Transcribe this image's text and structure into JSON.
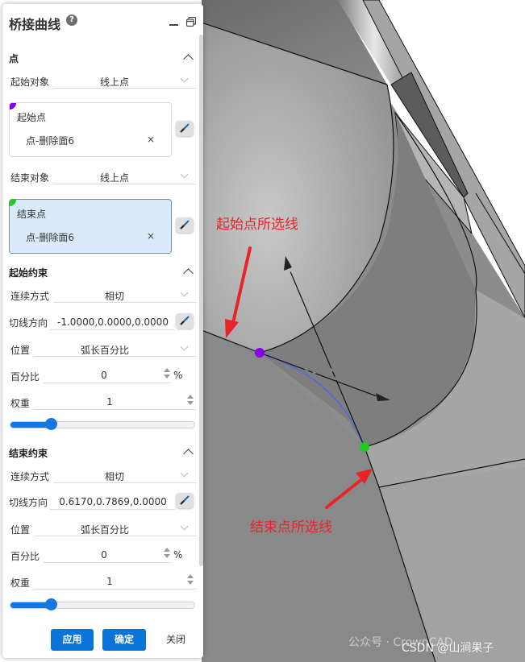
{
  "panel": {
    "title": "桥接曲线",
    "help_icon": "?",
    "sections": {
      "point": {
        "heading": "点",
        "start_object_label": "起始对象",
        "start_object_value": "线上点",
        "start_point": {
          "title": "起始点",
          "item": "点-删除面6",
          "remove": "×",
          "marker_color": "#8a00e6"
        },
        "end_object_label": "结束对象",
        "end_object_value": "线上点",
        "end_point": {
          "title": "结束点",
          "item": "点-删除面6",
          "remove": "×",
          "marker_color": "#1ecb1e"
        }
      },
      "start_constraint": {
        "heading": "起始约束",
        "continuity_label": "连续方式",
        "continuity_value": "相切",
        "tangent_label": "切线方向",
        "tangent_value": "-1.0000,0.0000,0.0000",
        "position_label": "位置",
        "position_value": "弧长百分比",
        "percent_label": "百分比",
        "percent_value": "0",
        "percent_unit": "%",
        "weight_label": "权重",
        "weight_value": "1",
        "weight_slider_fraction": 0.22
      },
      "end_constraint": {
        "heading": "结束约束",
        "continuity_label": "连续方式",
        "continuity_value": "相切",
        "tangent_label": "切线方向",
        "tangent_value": "0.6170,0.7869,0.0000",
        "position_label": "位置",
        "position_value": "弧长百分比",
        "percent_label": "百分比",
        "percent_value": "0",
        "percent_unit": "%",
        "weight_label": "权重",
        "weight_value": "1",
        "weight_slider_fraction": 0.22
      }
    },
    "buttons": {
      "apply": "应用",
      "ok": "确定",
      "close": "关闭"
    },
    "accent_color": "#0a74d8"
  },
  "viewport": {
    "annotations": {
      "start_line": "起始点所选线",
      "end_line": "结束点所选线"
    },
    "start_point_color": "#8a00e6",
    "end_point_color": "#1ecb1e",
    "bridge_curve_color": "#5570c8",
    "annotation_color": "#e8232a",
    "watermark_wechat": "公众号 · CrownCAD",
    "watermark_csdn": "CSDN @山涧果子"
  }
}
